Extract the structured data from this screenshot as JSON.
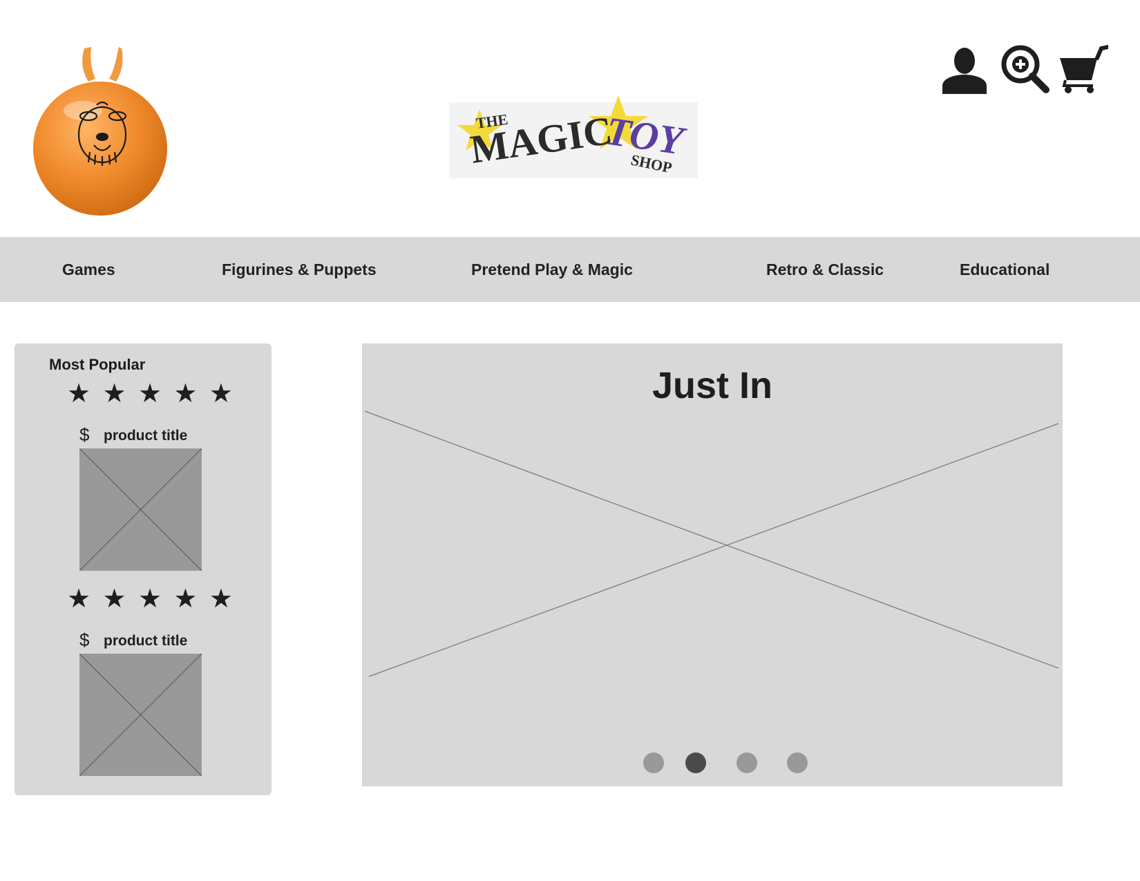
{
  "header": {
    "hopper_image": "space-hopper-toy",
    "logo": {
      "the": "THE",
      "magic": "MAGIC",
      "toy": "TOY",
      "shop": "SHOP"
    },
    "icons": [
      "user-icon",
      "search-icon",
      "cart-icon"
    ]
  },
  "nav": {
    "items": [
      {
        "label": "Games"
      },
      {
        "label": "Figurines & Puppets"
      },
      {
        "label": "Pretend Play & Magic"
      },
      {
        "label": "Retro & Classic"
      },
      {
        "label": "Educational"
      }
    ]
  },
  "sidebar": {
    "title": "Most Popular",
    "products": [
      {
        "rating": 5,
        "price_symbol": "$",
        "title": "product title"
      },
      {
        "rating": 5,
        "price_symbol": "$",
        "title": "product title"
      }
    ]
  },
  "carousel": {
    "title": "Just In",
    "slide_count": 4,
    "active_slide": 2
  },
  "colors": {
    "panel": "#d8d8d8",
    "placeholder": "#999999",
    "active_dot": "#4a4a4a",
    "hopper": "#f08a2c",
    "logo_star": "#f4d93a",
    "logo_toy": "#5b3fa0"
  }
}
